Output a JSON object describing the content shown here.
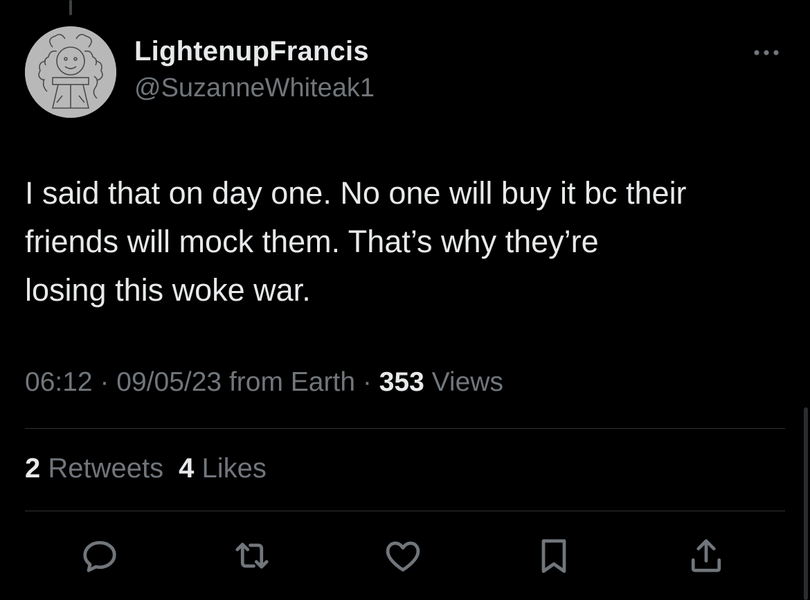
{
  "user": {
    "display_name": "LightenupFrancis",
    "handle": "@SuzanneWhiteak1",
    "avatar_icon": "sketch-avatar"
  },
  "tweet": {
    "lines": [
      "I said that on day one. No one will buy it bc their",
      "friends will mock them. That’s why they’re",
      "losing this woke war."
    ],
    "time": "06:12",
    "separator": "·",
    "date": "09/05/23",
    "source": "from Earth",
    "views_count": "353",
    "views_label": "Views"
  },
  "stats": {
    "retweets_count": "2",
    "retweets_label": "Retweets",
    "likes_count": "4",
    "likes_label": "Likes"
  },
  "actions": {
    "reply_icon": "reply-icon",
    "retweet_icon": "retweet-icon",
    "like_icon": "heart-icon",
    "bookmark_icon": "bookmark-icon",
    "share_icon": "share-icon",
    "more_icon": "more-dots-icon"
  },
  "colors": {
    "background": "#000000",
    "primary_text": "#e7e9ea",
    "secondary_text": "#71767b",
    "divider": "#2f3336"
  }
}
